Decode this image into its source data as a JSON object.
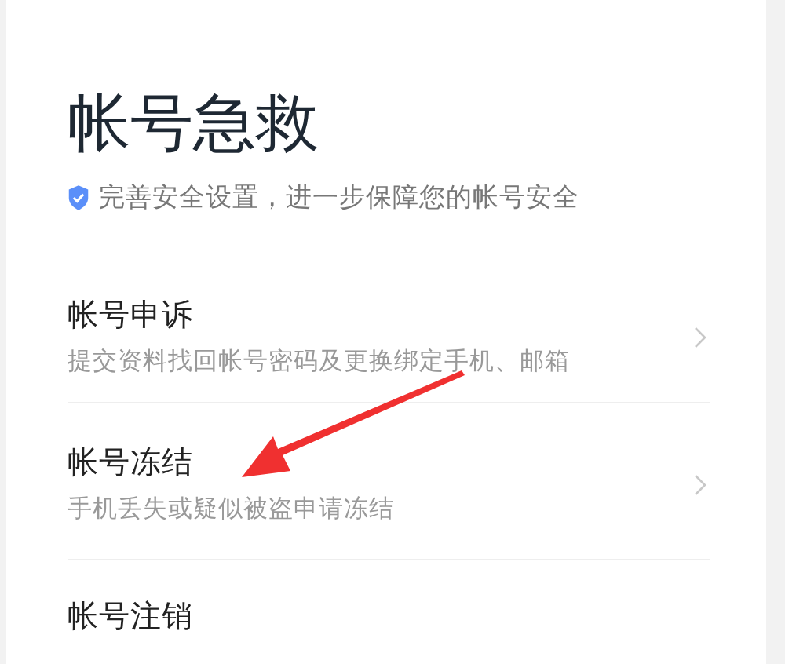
{
  "header": {
    "title": "帐号急救",
    "subtitle": "完善安全设置，进一步保障您的帐号安全"
  },
  "items": [
    {
      "title": "帐号申诉",
      "description": "提交资料找回帐号密码及更换绑定手机、邮箱"
    },
    {
      "title": "帐号冻结",
      "description": "手机丢失或疑似被盗申请冻结"
    },
    {
      "title": "帐号注销"
    }
  ]
}
